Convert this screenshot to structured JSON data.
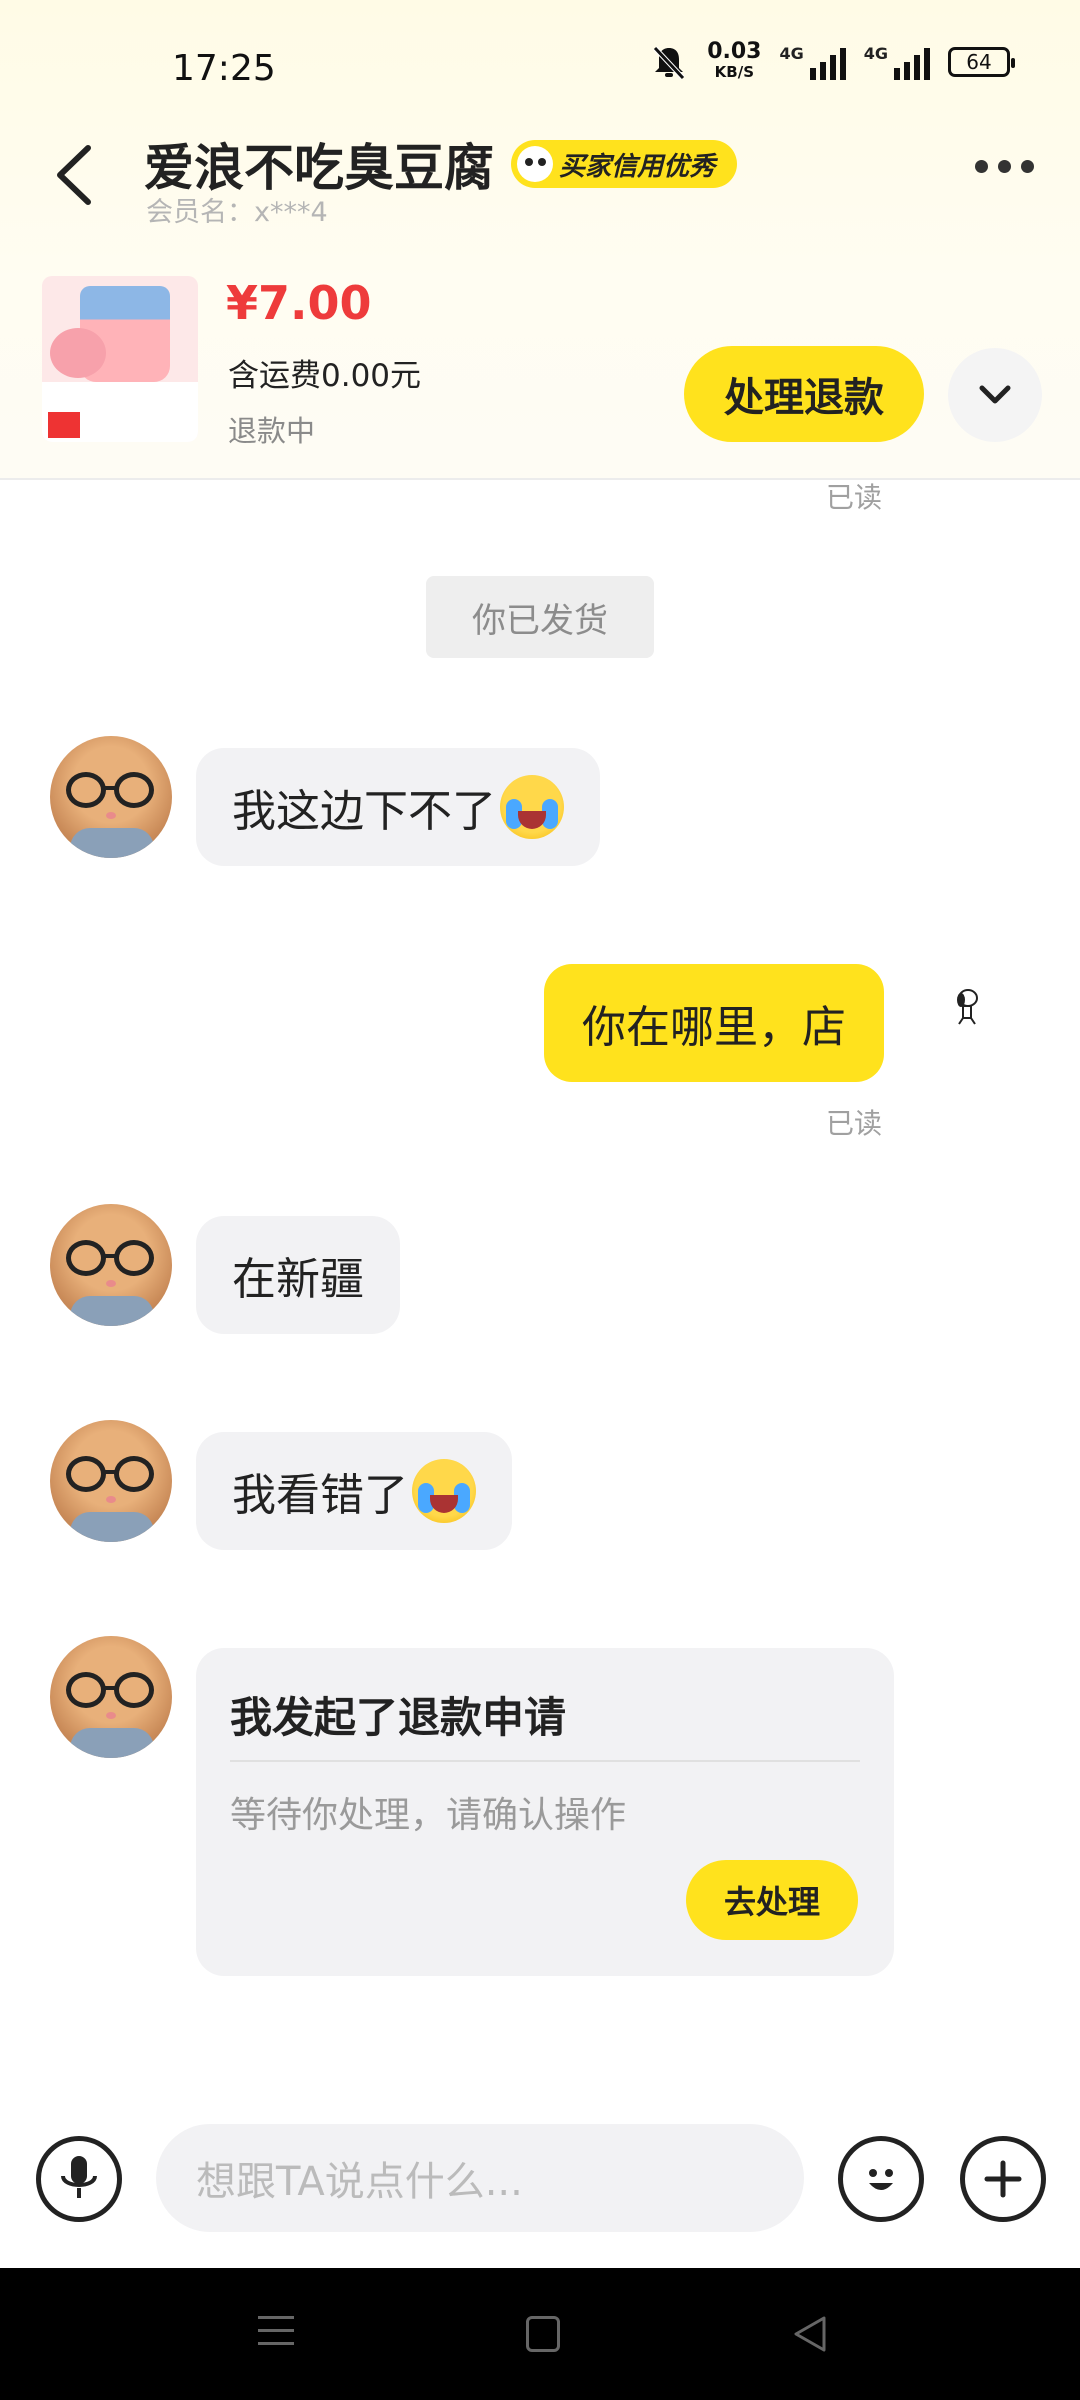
{
  "status_bar": {
    "time": "17:25",
    "net_speed_value": "0.03",
    "net_speed_unit": "KB/S",
    "signal_1_label": "4G",
    "signal_2_label": "4G",
    "battery": "64"
  },
  "header": {
    "chat_title": "爱浪不吃臭豆腐",
    "credit_badge": "买家信用优秀",
    "member_name": "会员名：x***4"
  },
  "product": {
    "price": "¥7.00",
    "shipping": "含运费0.00元",
    "status": "退款中",
    "handle_refund_label": "处理退款"
  },
  "messages": {
    "read_1": "已读",
    "system_shipped": "你已发货",
    "incoming_1": "我这边下不了",
    "outgoing_1": "你在哪里，店",
    "read_2": "已读",
    "incoming_2": "在新疆",
    "incoming_3": "我看错了",
    "refund_card": {
      "title": "我发起了退款申请",
      "description": "等待你处理，请确认操作",
      "action_label": "去处理"
    }
  },
  "input": {
    "placeholder": "想跟TA说点什么..."
  },
  "colors": {
    "accent_yellow": "#ffe21d",
    "price_red": "#ee3b3b"
  },
  "icons": {
    "back": "chevron-left-icon",
    "more": "more-dots-icon",
    "expand": "chevron-down-icon",
    "mic": "microphone-icon",
    "emoji": "smiley-icon",
    "plus": "plus-icon",
    "bell_off": "bell-off-icon"
  }
}
